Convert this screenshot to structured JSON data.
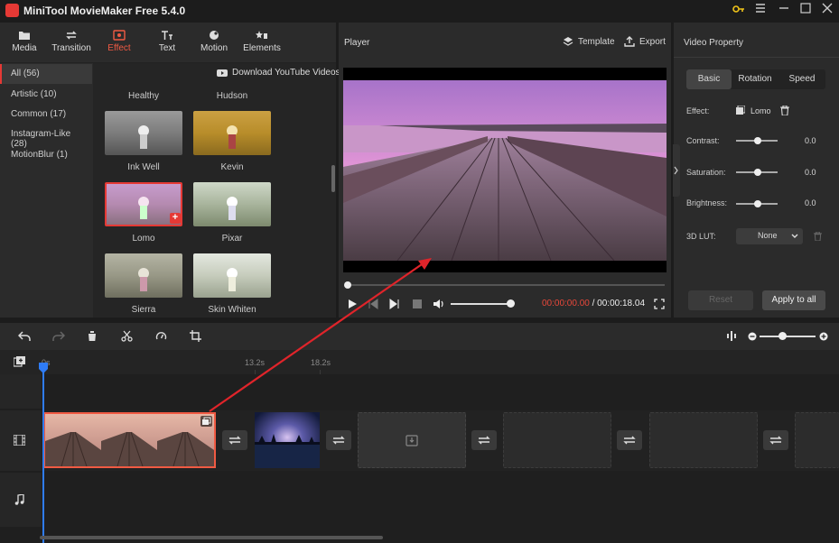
{
  "app": {
    "title": "MiniTool MovieMaker Free 5.4.0"
  },
  "toolbar": [
    {
      "label": "Media",
      "icon": "folder-icon"
    },
    {
      "label": "Transition",
      "icon": "transition-icon"
    },
    {
      "label": "Effect",
      "icon": "effect-icon"
    },
    {
      "label": "Text",
      "icon": "text-icon"
    },
    {
      "label": "Motion",
      "icon": "motion-icon"
    },
    {
      "label": "Elements",
      "icon": "elements-icon"
    }
  ],
  "categories": [
    "All (56)",
    "Artistic (10)",
    "Common (17)",
    "Instagram-Like (28)",
    "MotionBlur (1)"
  ],
  "download_label": "Download YouTube Videos",
  "effects": {
    "top_labels": [
      "Healthy",
      "Hudson"
    ],
    "items": [
      "Ink Well",
      "Kevin",
      "Lomo",
      "Pixar",
      "Sierra",
      "Skin Whiten"
    ]
  },
  "player": {
    "title": "Player",
    "template_label": "Template",
    "export_label": "Export",
    "current_time": "00:00:00.00",
    "separator": " / ",
    "total_time": "00:00:18.04"
  },
  "property": {
    "title": "Video Property",
    "tabs": [
      "Basic",
      "Rotation",
      "Speed"
    ],
    "effect_label": "Effect:",
    "effect_value": "Lomo",
    "sliders": [
      {
        "label": "Contrast:",
        "value": "0.0"
      },
      {
        "label": "Saturation:",
        "value": "0.0"
      },
      {
        "label": "Brightness:",
        "value": "0.0"
      }
    ],
    "lut_label": "3D LUT:",
    "lut_value": "None",
    "reset_label": "Reset",
    "apply_label": "Apply to all"
  },
  "timeline": {
    "ticks": [
      "0s",
      "13.2s",
      "18.2s"
    ]
  },
  "colors": {
    "accent": "#e53935",
    "time_red": "#e8473a"
  }
}
